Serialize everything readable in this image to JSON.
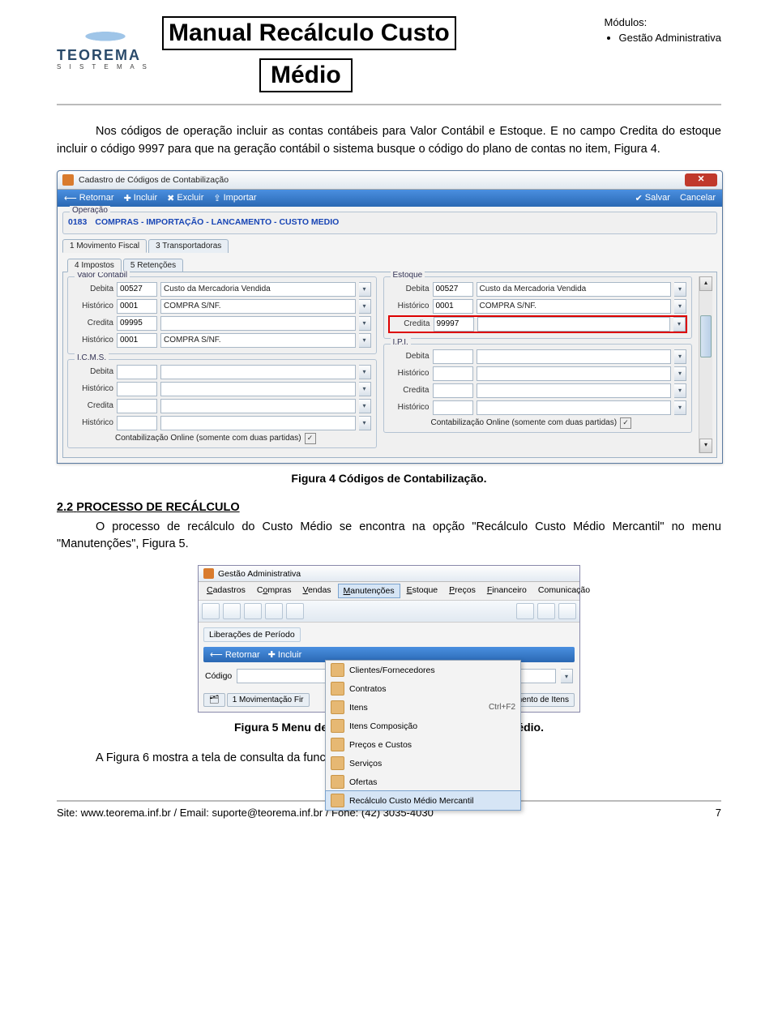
{
  "header": {
    "logo_name": "TEOREMA",
    "logo_sub": "S I S T E M A S",
    "title1": "Manual Recálculo Custo",
    "title2": "Médio",
    "mod_label": "Módulos:",
    "mod_item": "Gestão Administrativa"
  },
  "para1": "Nos códigos de operação incluir as contas contábeis para Valor Contábil e Estoque. E no campo Credita do estoque incluir o código 9997 para que na geração contábil o sistema busque o código do plano de contas no item, Figura 4.",
  "win1": {
    "title": "Cadastro de Códigos de Contabilização",
    "toolbar": {
      "retornar": "Retornar",
      "incluir": "Incluir",
      "excluir": "Excluir",
      "importar": "Importar",
      "salvar": "Salvar",
      "cancelar": "Cancelar"
    },
    "operacao_label": "Operação",
    "op_code": "0183",
    "op_desc": "COMPRAS - IMPORTAÇÃO - LANCAMENTO - CUSTO MEDIO",
    "tabs_upper": [
      "1 Movimento Fiscal",
      "3 Transportadoras"
    ],
    "tabs_lower": [
      "4 Impostos",
      "5 Retenções"
    ],
    "valor_contabil": "Valor Contábil",
    "estoque": "Estoque",
    "icms": "I.C.M.S.",
    "ipi": "I.P.I.",
    "labels": {
      "debita": "Debita",
      "historico": "Histórico",
      "credita": "Credita"
    },
    "vc": {
      "debita_code": "00527",
      "debita_desc": "Custo da Mercadoria Vendida",
      "hist1_code": "0001",
      "hist1_desc": "COMPRA S/NF.",
      "credita_code": "09995",
      "credita_desc": "",
      "hist2_code": "0001",
      "hist2_desc": "COMPRA S/NF."
    },
    "est": {
      "debita_code": "00527",
      "debita_desc": "Custo da Mercadoria Vendida",
      "hist1_code": "0001",
      "hist1_desc": "COMPRA S/NF.",
      "credita_code": "99997",
      "credita_desc": ""
    },
    "online_chk": "Contabilização Online (somente com duas partidas)"
  },
  "caption1": "Figura 4 Códigos de Contabilização.",
  "section": {
    "num": "2.2",
    "title": "PROCESSO DE RECÁLCULO"
  },
  "para2": "O processo de recálculo do Custo Médio se encontra na opção \"Recálculo Custo Médio Mercantil\" no menu \"Manutenções\", Figura 5.",
  "win2": {
    "title": "Gestão Administrativa",
    "menus": [
      "Cadastros",
      "Compras",
      "Vendas",
      "Manutenções",
      "Estoque",
      "Preços",
      "Financeiro",
      "Comunicação"
    ],
    "dropdown": [
      {
        "label": "Clientes/Fornecedores",
        "sc": ""
      },
      {
        "label": "Contratos",
        "sc": ""
      },
      {
        "label": "Itens",
        "sc": "Ctrl+F2"
      },
      {
        "label": "Itens Composição",
        "sc": ""
      },
      {
        "label": "Preços e Custos",
        "sc": ""
      },
      {
        "label": "Serviços",
        "sc": ""
      },
      {
        "label": "Ofertas",
        "sc": ""
      },
      {
        "label": "Recálculo Custo Médio Mercantil",
        "sc": ""
      }
    ],
    "lib": "Liberações de Período",
    "retornar": "Retornar",
    "incluir": "Incluir",
    "codigo": "Código",
    "tab_bottom": "1 Movimentação Fir",
    "right_slice": "ovimento de Itens"
  },
  "caption2": "Figura 5 Menu de acesso de Recálculo para Custo Médio.",
  "para3": "A Figura 6 mostra a tela de consulta da funcionalidade de recálculo.",
  "footer": {
    "left": "Site: www.teorema.inf.br / Email: suporte@teorema.inf.br / Fone: (42) 3035-4030",
    "right": "7"
  }
}
